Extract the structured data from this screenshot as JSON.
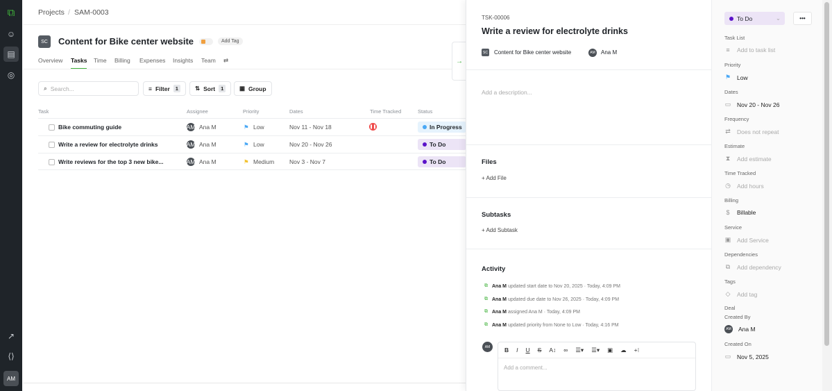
{
  "breadcrumb": {
    "root": "Projects",
    "sep": "/",
    "current": "SAM-0003"
  },
  "project": {
    "avatar": "SC",
    "title": "Content for Bike center website",
    "add_tag": "Add Tag"
  },
  "tabs": [
    "Overview",
    "Tasks",
    "Time",
    "Billing",
    "Expenses",
    "Insights",
    "Team"
  ],
  "toolbar": {
    "search_placeholder": "Search...",
    "filter": "Filter",
    "filter_count": "1",
    "sort": "Sort",
    "sort_count": "1",
    "group": "Group"
  },
  "table": {
    "headers": [
      "Task",
      "Assignee",
      "Priority",
      "Dates",
      "Time Tracked",
      "Status"
    ],
    "rows": [
      {
        "task": "Bike commuting guide",
        "assignee": "Ana M",
        "avatar": "AM",
        "priority": "Low",
        "dates": "Nov 11 - Nov 18",
        "status": "In Progress"
      },
      {
        "task": "Write a review for electrolyte drinks",
        "assignee": "Ana M",
        "avatar": "AM",
        "priority": "Low",
        "dates": "Nov 20 - Nov 26",
        "status": "To Do"
      },
      {
        "task": "Write reviews for the top 3 new bike...",
        "assignee": "Ana M",
        "avatar": "AM",
        "priority": "Medium",
        "dates": "Nov 3 - Nov 7",
        "status": "To Do"
      }
    ]
  },
  "task": {
    "id": "TSK-00006",
    "title": "Write a review for electrolyte drinks",
    "project_avatar": "SC",
    "project": "Content for Bike center website",
    "assignee_avatar": "AM",
    "assignee": "Ana M",
    "description_placeholder": "Add a description...",
    "files_title": "Files",
    "add_file": "+ Add File",
    "subtasks_title": "Subtasks",
    "add_subtask": "+ Add Subtask",
    "activity_title": "Activity",
    "activity": [
      {
        "user": "Ana M",
        "text": "updated start date to Nov 20, 2025 · Today, 4:09 PM"
      },
      {
        "user": "Ana M",
        "text": "updated due date to Nov 26, 2025 · Today, 4:09 PM"
      },
      {
        "user": "Ana M",
        "text": "assigned Ana M · Today, 4:09 PM"
      },
      {
        "user": "Ana M",
        "text": "updated priority from None to Low · Today, 4:16 PM"
      }
    ],
    "comment_avatar": "AM",
    "comment_placeholder": "Add a comment..."
  },
  "props": {
    "status": "To Do",
    "more": "•••",
    "task_list_label": "Task List",
    "task_list": "Add to task list",
    "priority_label": "Priority",
    "priority": "Low",
    "dates_label": "Dates",
    "dates": "Nov 20 - Nov 26",
    "frequency_label": "Frequency",
    "frequency": "Does not repeat",
    "estimate_label": "Estimate",
    "estimate": "Add estimate",
    "time_label": "Time Tracked",
    "time": "Add hours",
    "billing_label": "Billing",
    "billing": "Billable",
    "service_label": "Service",
    "service": "Add Service",
    "dependencies_label": "Dependencies",
    "dependencies": "Add dependency",
    "tags_label": "Tags",
    "tags": "Add tag",
    "deal_label": "Deal",
    "created_by_label": "Created By",
    "created_by_avatar": "AM",
    "created_by": "Ana M",
    "created_on_label": "Created On",
    "created_on": "Nov 5, 2025"
  },
  "user_avatar": "AM",
  "colors": {
    "accent": "#3fb23a",
    "todo": "#5b12c9",
    "inprogress": "#4aa8f5",
    "low": "#4aa8f5",
    "medium": "#f2c12e"
  }
}
